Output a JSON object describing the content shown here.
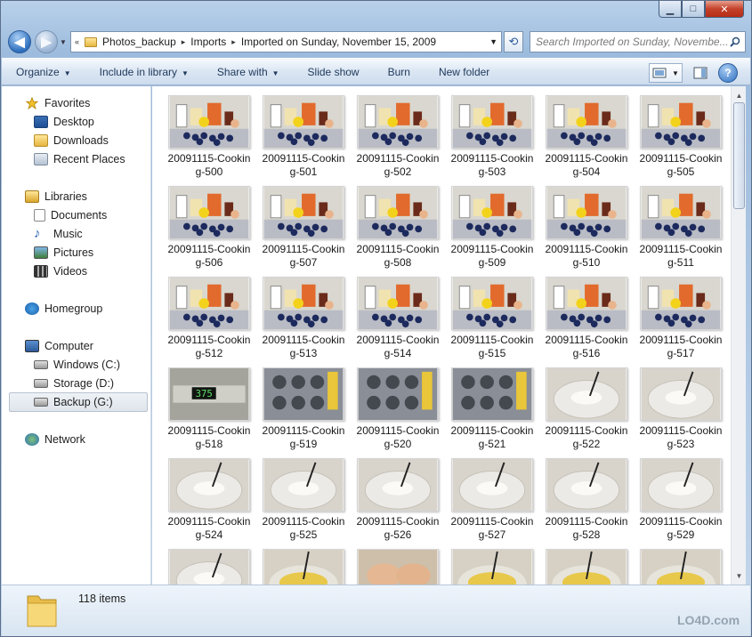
{
  "window": {
    "controls": {
      "minimize": "▁",
      "maximize": "□",
      "close": "✕"
    }
  },
  "nav": {
    "back": "◀",
    "forward": "▶",
    "recent": "▼"
  },
  "address": {
    "crumbs": [
      "Photos_backup",
      "Imports",
      "Imported on Sunday, November 15, 2009"
    ],
    "prefix": "«",
    "separator": "▸",
    "dropdown": "▼",
    "refresh": "⟲"
  },
  "search": {
    "placeholder": "Search Imported on Sunday, Novembe..."
  },
  "toolbar": {
    "items": [
      {
        "label": "Organize",
        "dropdown": true
      },
      {
        "label": "Include in library",
        "dropdown": true
      },
      {
        "label": "Share with",
        "dropdown": true
      },
      {
        "label": "Slide show",
        "dropdown": false
      },
      {
        "label": "Burn",
        "dropdown": false
      },
      {
        "label": "New folder",
        "dropdown": false
      }
    ],
    "help": "?"
  },
  "sidebar": {
    "favorites": {
      "label": "Favorites",
      "items": [
        "Desktop",
        "Downloads",
        "Recent Places"
      ]
    },
    "libraries": {
      "label": "Libraries",
      "items": [
        "Documents",
        "Music",
        "Pictures",
        "Videos"
      ]
    },
    "homegroup": {
      "label": "Homegroup"
    },
    "computer": {
      "label": "Computer",
      "items": [
        "Windows (C:)",
        "Storage (D:)",
        "Backup (G:)"
      ],
      "selected": "Backup (G:)"
    },
    "network": {
      "label": "Network"
    }
  },
  "files": [
    {
      "name1": "20091115-Cookin",
      "name2": "g-500",
      "scene": "ingredients"
    },
    {
      "name1": "20091115-Cookin",
      "name2": "g-501",
      "scene": "ingredients"
    },
    {
      "name1": "20091115-Cookin",
      "name2": "g-502",
      "scene": "ingredients"
    },
    {
      "name1": "20091115-Cookin",
      "name2": "g-503",
      "scene": "ingredients"
    },
    {
      "name1": "20091115-Cookin",
      "name2": "g-504",
      "scene": "ingredients"
    },
    {
      "name1": "20091115-Cookin",
      "name2": "g-505",
      "scene": "ingredients"
    },
    {
      "name1": "20091115-Cookin",
      "name2": "g-506",
      "scene": "ingredients"
    },
    {
      "name1": "20091115-Cookin",
      "name2": "g-507",
      "scene": "ingredients"
    },
    {
      "name1": "20091115-Cookin",
      "name2": "g-508",
      "scene": "ingredients"
    },
    {
      "name1": "20091115-Cookin",
      "name2": "g-509",
      "scene": "ingredients"
    },
    {
      "name1": "20091115-Cookin",
      "name2": "g-510",
      "scene": "ingredients"
    },
    {
      "name1": "20091115-Cookin",
      "name2": "g-511",
      "scene": "ingredients"
    },
    {
      "name1": "20091115-Cookin",
      "name2": "g-512",
      "scene": "ingredients"
    },
    {
      "name1": "20091115-Cookin",
      "name2": "g-513",
      "scene": "ingredients"
    },
    {
      "name1": "20091115-Cookin",
      "name2": "g-514",
      "scene": "ingredients"
    },
    {
      "name1": "20091115-Cookin",
      "name2": "g-515",
      "scene": "ingredients"
    },
    {
      "name1": "20091115-Cookin",
      "name2": "g-516",
      "scene": "ingredients"
    },
    {
      "name1": "20091115-Cookin",
      "name2": "g-517",
      "scene": "ingredients"
    },
    {
      "name1": "20091115-Cookin",
      "name2": "g-518",
      "scene": "oven",
      "display": "375"
    },
    {
      "name1": "20091115-Cookin",
      "name2": "g-519",
      "scene": "tin"
    },
    {
      "name1": "20091115-Cookin",
      "name2": "g-520",
      "scene": "tin"
    },
    {
      "name1": "20091115-Cookin",
      "name2": "g-521",
      "scene": "tin"
    },
    {
      "name1": "20091115-Cookin",
      "name2": "g-522",
      "scene": "bowl"
    },
    {
      "name1": "20091115-Cookin",
      "name2": "g-523",
      "scene": "bowl"
    },
    {
      "name1": "20091115-Cookin",
      "name2": "g-524",
      "scene": "bowl"
    },
    {
      "name1": "20091115-Cookin",
      "name2": "g-525",
      "scene": "bowl"
    },
    {
      "name1": "20091115-Cookin",
      "name2": "g-526",
      "scene": "bowl"
    },
    {
      "name1": "20091115-Cookin",
      "name2": "g-527",
      "scene": "bowl"
    },
    {
      "name1": "20091115-Cookin",
      "name2": "g-528",
      "scene": "bowl"
    },
    {
      "name1": "20091115-Cookin",
      "name2": "g-529",
      "scene": "bowl"
    },
    {
      "name1": "",
      "name2": "",
      "scene": "bowl"
    },
    {
      "name1": "",
      "name2": "",
      "scene": "batter"
    },
    {
      "name1": "",
      "name2": "",
      "scene": "hands"
    },
    {
      "name1": "",
      "name2": "",
      "scene": "batter"
    },
    {
      "name1": "",
      "name2": "",
      "scene": "batter"
    },
    {
      "name1": "",
      "name2": "",
      "scene": "batter"
    }
  ],
  "status": {
    "count": "118 items"
  },
  "watermark": "LO4D.com"
}
